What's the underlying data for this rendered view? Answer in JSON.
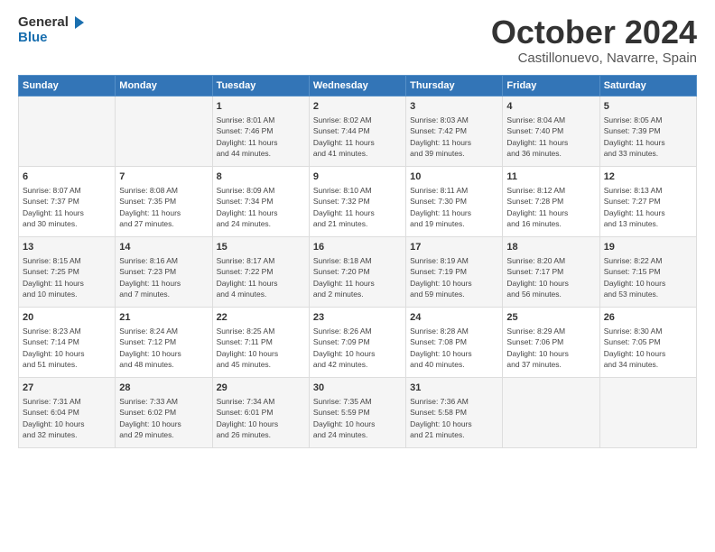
{
  "header": {
    "logo_general": "General",
    "logo_blue": "Blue",
    "month": "October 2024",
    "location": "Castillonuevo, Navarre, Spain"
  },
  "days_of_week": [
    "Sunday",
    "Monday",
    "Tuesday",
    "Wednesday",
    "Thursday",
    "Friday",
    "Saturday"
  ],
  "weeks": [
    [
      {
        "day": "",
        "info": ""
      },
      {
        "day": "",
        "info": ""
      },
      {
        "day": "1",
        "info": "Sunrise: 8:01 AM\nSunset: 7:46 PM\nDaylight: 11 hours\nand 44 minutes."
      },
      {
        "day": "2",
        "info": "Sunrise: 8:02 AM\nSunset: 7:44 PM\nDaylight: 11 hours\nand 41 minutes."
      },
      {
        "day": "3",
        "info": "Sunrise: 8:03 AM\nSunset: 7:42 PM\nDaylight: 11 hours\nand 39 minutes."
      },
      {
        "day": "4",
        "info": "Sunrise: 8:04 AM\nSunset: 7:40 PM\nDaylight: 11 hours\nand 36 minutes."
      },
      {
        "day": "5",
        "info": "Sunrise: 8:05 AM\nSunset: 7:39 PM\nDaylight: 11 hours\nand 33 minutes."
      }
    ],
    [
      {
        "day": "6",
        "info": "Sunrise: 8:07 AM\nSunset: 7:37 PM\nDaylight: 11 hours\nand 30 minutes."
      },
      {
        "day": "7",
        "info": "Sunrise: 8:08 AM\nSunset: 7:35 PM\nDaylight: 11 hours\nand 27 minutes."
      },
      {
        "day": "8",
        "info": "Sunrise: 8:09 AM\nSunset: 7:34 PM\nDaylight: 11 hours\nand 24 minutes."
      },
      {
        "day": "9",
        "info": "Sunrise: 8:10 AM\nSunset: 7:32 PM\nDaylight: 11 hours\nand 21 minutes."
      },
      {
        "day": "10",
        "info": "Sunrise: 8:11 AM\nSunset: 7:30 PM\nDaylight: 11 hours\nand 19 minutes."
      },
      {
        "day": "11",
        "info": "Sunrise: 8:12 AM\nSunset: 7:28 PM\nDaylight: 11 hours\nand 16 minutes."
      },
      {
        "day": "12",
        "info": "Sunrise: 8:13 AM\nSunset: 7:27 PM\nDaylight: 11 hours\nand 13 minutes."
      }
    ],
    [
      {
        "day": "13",
        "info": "Sunrise: 8:15 AM\nSunset: 7:25 PM\nDaylight: 11 hours\nand 10 minutes."
      },
      {
        "day": "14",
        "info": "Sunrise: 8:16 AM\nSunset: 7:23 PM\nDaylight: 11 hours\nand 7 minutes."
      },
      {
        "day": "15",
        "info": "Sunrise: 8:17 AM\nSunset: 7:22 PM\nDaylight: 11 hours\nand 4 minutes."
      },
      {
        "day": "16",
        "info": "Sunrise: 8:18 AM\nSunset: 7:20 PM\nDaylight: 11 hours\nand 2 minutes."
      },
      {
        "day": "17",
        "info": "Sunrise: 8:19 AM\nSunset: 7:19 PM\nDaylight: 10 hours\nand 59 minutes."
      },
      {
        "day": "18",
        "info": "Sunrise: 8:20 AM\nSunset: 7:17 PM\nDaylight: 10 hours\nand 56 minutes."
      },
      {
        "day": "19",
        "info": "Sunrise: 8:22 AM\nSunset: 7:15 PM\nDaylight: 10 hours\nand 53 minutes."
      }
    ],
    [
      {
        "day": "20",
        "info": "Sunrise: 8:23 AM\nSunset: 7:14 PM\nDaylight: 10 hours\nand 51 minutes."
      },
      {
        "day": "21",
        "info": "Sunrise: 8:24 AM\nSunset: 7:12 PM\nDaylight: 10 hours\nand 48 minutes."
      },
      {
        "day": "22",
        "info": "Sunrise: 8:25 AM\nSunset: 7:11 PM\nDaylight: 10 hours\nand 45 minutes."
      },
      {
        "day": "23",
        "info": "Sunrise: 8:26 AM\nSunset: 7:09 PM\nDaylight: 10 hours\nand 42 minutes."
      },
      {
        "day": "24",
        "info": "Sunrise: 8:28 AM\nSunset: 7:08 PM\nDaylight: 10 hours\nand 40 minutes."
      },
      {
        "day": "25",
        "info": "Sunrise: 8:29 AM\nSunset: 7:06 PM\nDaylight: 10 hours\nand 37 minutes."
      },
      {
        "day": "26",
        "info": "Sunrise: 8:30 AM\nSunset: 7:05 PM\nDaylight: 10 hours\nand 34 minutes."
      }
    ],
    [
      {
        "day": "27",
        "info": "Sunrise: 7:31 AM\nSunset: 6:04 PM\nDaylight: 10 hours\nand 32 minutes."
      },
      {
        "day": "28",
        "info": "Sunrise: 7:33 AM\nSunset: 6:02 PM\nDaylight: 10 hours\nand 29 minutes."
      },
      {
        "day": "29",
        "info": "Sunrise: 7:34 AM\nSunset: 6:01 PM\nDaylight: 10 hours\nand 26 minutes."
      },
      {
        "day": "30",
        "info": "Sunrise: 7:35 AM\nSunset: 5:59 PM\nDaylight: 10 hours\nand 24 minutes."
      },
      {
        "day": "31",
        "info": "Sunrise: 7:36 AM\nSunset: 5:58 PM\nDaylight: 10 hours\nand 21 minutes."
      },
      {
        "day": "",
        "info": ""
      },
      {
        "day": "",
        "info": ""
      }
    ]
  ]
}
